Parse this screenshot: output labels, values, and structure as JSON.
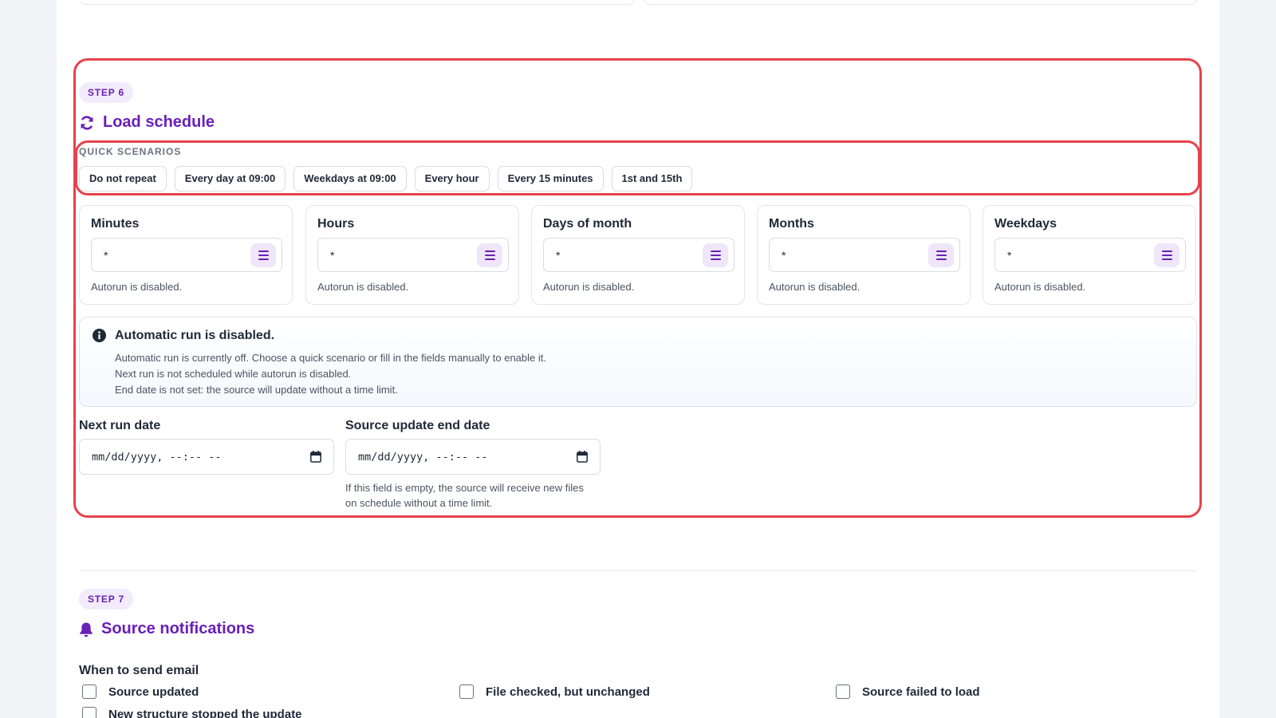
{
  "step6": {
    "badge": "STEP 6",
    "title": "Load schedule",
    "quick_scenarios_label": "QUICK SCENARIOS",
    "scenarios": [
      "Do not repeat",
      "Every day at 09:00",
      "Weekdays at 09:00",
      "Every hour",
      "Every 15 minutes",
      "1st and 15th"
    ],
    "cron_fields": [
      {
        "label": "Minutes",
        "value": "*",
        "hint": "Autorun is disabled."
      },
      {
        "label": "Hours",
        "value": "*",
        "hint": "Autorun is disabled."
      },
      {
        "label": "Days of month",
        "value": "*",
        "hint": "Autorun is disabled."
      },
      {
        "label": "Months",
        "value": "*",
        "hint": "Autorun is disabled."
      },
      {
        "label": "Weekdays",
        "value": "*",
        "hint": "Autorun is disabled."
      }
    ],
    "info": {
      "title": "Automatic run is disabled.",
      "lines": [
        "Automatic run is currently off. Choose a quick scenario or fill in the fields manually to enable it.",
        "Next run is not scheduled while autorun is disabled.",
        "End date is not set: the source will update without a time limit."
      ]
    },
    "next_run": {
      "label": "Next run date",
      "placeholder": "mm/dd/yyyy, --:-- --"
    },
    "end_date": {
      "label": "Source update end date",
      "placeholder": "mm/dd/yyyy, --:-- --",
      "hint_lines": [
        "If this field is empty, the source will receive new files",
        "on schedule without a time limit."
      ]
    }
  },
  "step7": {
    "badge": "STEP 7",
    "title": "Source notifications",
    "email_label": "When to send email",
    "options": [
      "Source updated",
      "File checked, but unchanged",
      "Source failed to load",
      "New structure stopped the update"
    ]
  },
  "colors": {
    "accent": "#6a1fb7",
    "highlight": "#e5434b"
  }
}
